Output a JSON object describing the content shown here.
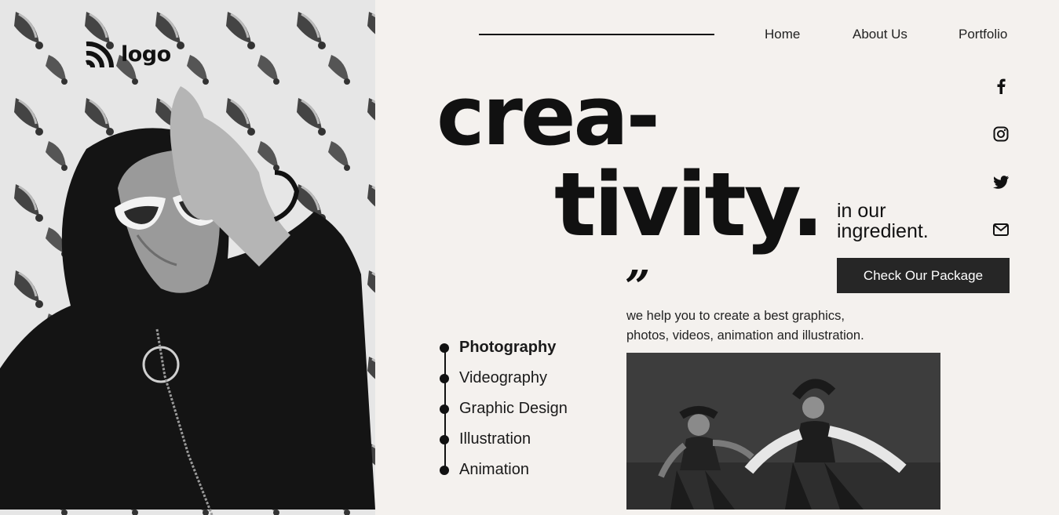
{
  "brand": {
    "logo_text": "logo",
    "logo_icon": "rss-arc-icon"
  },
  "nav": {
    "links": [
      "Home",
      "About Us",
      "Portfolio"
    ]
  },
  "hero": {
    "headline_line1": "crea-",
    "headline_line2": "tivity.",
    "tagline_line1": "in our",
    "tagline_line2": "ingredient.",
    "cta_label": "Check Our Package",
    "quote_mark": "”",
    "description_line1": "we help you to create a best graphics,",
    "description_line2": "photos, videos, animation and illustration."
  },
  "services": {
    "items": [
      "Photography",
      "Videography",
      "Graphic Design",
      "Illustration",
      "Animation"
    ],
    "active": "Photography"
  },
  "social": [
    "facebook-icon",
    "instagram-icon",
    "twitter-icon",
    "mail-icon"
  ],
  "colors": {
    "background": "#f4f1ee",
    "accent": "#262626",
    "text": "#111111"
  }
}
